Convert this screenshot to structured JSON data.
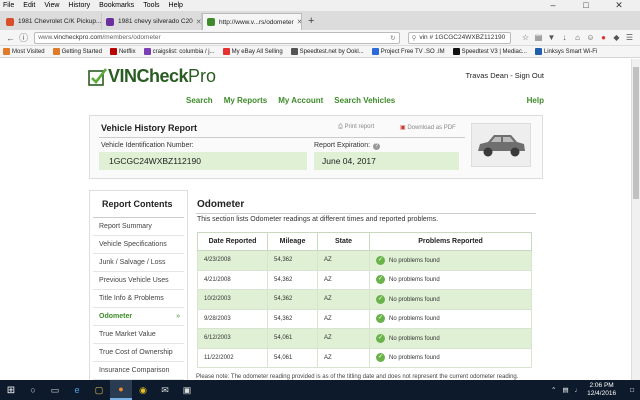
{
  "menubar": {
    "items": [
      "File",
      "Edit",
      "View",
      "History",
      "Bookmarks",
      "Tools",
      "Help"
    ]
  },
  "tabs": [
    {
      "label": "1981 Chevrolet C/K Pickup...",
      "color": "#d94f2b"
    },
    {
      "label": "1981 chevy silverado C20",
      "color": "#6b2fa0"
    },
    {
      "label": "http://www.v...rs/odometer",
      "color": "#3e8b2a"
    }
  ],
  "nav": {
    "url_prefix": "www.",
    "url_host": "vincheckpro.com",
    "url_path": "/members/odometer",
    "search_value": "vin # 1GCGC24WXBZ112190"
  },
  "bookmarks": [
    {
      "label": "Most Visited",
      "color": "#e07b2a"
    },
    {
      "label": "Getting Started",
      "color": "#e07b2a"
    },
    {
      "label": "Netflix",
      "color": "#b00"
    },
    {
      "label": "craigslist: columbia / j...",
      "color": "#7a3fb3"
    },
    {
      "label": "My eBay All Selling",
      "color": "#e5312f"
    },
    {
      "label": "Speedtest.net by Ookl...",
      "color": "#555"
    },
    {
      "label": "Project Free TV .SO .IM",
      "color": "#2a6ad9"
    },
    {
      "label": "Speedtest V3 | Mediac...",
      "color": "#111"
    },
    {
      "label": "Linksys Smart Wi-Fi",
      "color": "#1f5fae"
    }
  ],
  "header": {
    "logo_vin": "VINCheck",
    "logo_pro": "Pro",
    "user": "Travas Dean - Sign Out",
    "nav": [
      "Search",
      "My Reports",
      "My Account",
      "Search Vehicles"
    ],
    "help": "Help"
  },
  "report": {
    "title": "Vehicle History Report",
    "print": "Print report",
    "pdf": "Download as PDF",
    "vin_label": "Vehicle Identification Number:",
    "vin_value": "1GCGC24WXBZ112190",
    "exp_label": "Report Expiration:",
    "exp_value": "June 04, 2017"
  },
  "sidebar": {
    "title": "Report Contents",
    "items": [
      "Report Summary",
      "Vehicle Specifications",
      "Junk / Salvage / Loss",
      "Previous Vehicle Uses",
      "Title Info & Problems",
      "Odometer",
      "True Market Value",
      "True Cost of Ownership",
      "Insurance Comparison"
    ],
    "active_index": 5
  },
  "odometer": {
    "title": "Odometer",
    "description": "This section lists Odometer readings at different times and reported problems.",
    "columns": [
      "Date Reported",
      "Mileage",
      "State",
      "Problems Reported"
    ],
    "rows": [
      {
        "date": "4/23/2008",
        "mileage": "54,362",
        "state": "AZ",
        "problem": "No problems found"
      },
      {
        "date": "4/21/2008",
        "mileage": "54,362",
        "state": "AZ",
        "problem": "No problems found"
      },
      {
        "date": "10/2/2003",
        "mileage": "54,362",
        "state": "AZ",
        "problem": "No problems found"
      },
      {
        "date": "9/28/2003",
        "mileage": "54,362",
        "state": "AZ",
        "problem": "No problems found"
      },
      {
        "date": "6/12/2003",
        "mileage": "54,061",
        "state": "AZ",
        "problem": "No problems found"
      },
      {
        "date": "11/22/2002",
        "mileage": "54,061",
        "state": "AZ",
        "problem": "No problems found"
      }
    ],
    "note": "Please note: The odometer reading provided is as of the titling date and does not represent the current odometer reading."
  },
  "taskbar": {
    "time": "2:06 PM",
    "date": "12/4/2016"
  },
  "colors": {
    "brand_green": "#3e8b2a",
    "row_shade": "#dff0d4"
  }
}
